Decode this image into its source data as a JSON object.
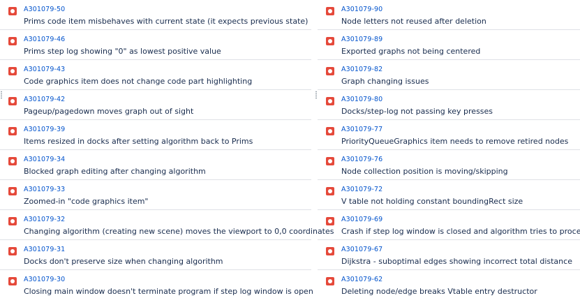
{
  "left_column": [
    {
      "key": "A301079-50",
      "summary": "Prims code item misbehaves with current state (it expects previous state)"
    },
    {
      "key": "A301079-46",
      "summary": "Prims step log showing \"0\" as lowest positive value"
    },
    {
      "key": "A301079-43",
      "summary": "Code graphics item does not change code part highlighting"
    },
    {
      "key": "A301079-42",
      "summary": "Pageup/pagedown moves graph out of sight"
    },
    {
      "key": "A301079-39",
      "summary": "Items resized in docks after setting algorithm back to Prims"
    },
    {
      "key": "A301079-34",
      "summary": "Blocked graph editing after changing algorithm"
    },
    {
      "key": "A301079-33",
      "summary": "Zoomed-in \"code graphics item\""
    },
    {
      "key": "A301079-32",
      "summary": "Changing algorithm (creating new scene) moves the viewport to 0,0 coordinates"
    },
    {
      "key": "A301079-31",
      "summary": "Docks don't preserve size when changing algorithm"
    },
    {
      "key": "A301079-30",
      "summary": "Closing main window doesn't terminate program if step log window is open"
    }
  ],
  "right_column": [
    {
      "key": "A301079-90",
      "summary": "Node letters not reused after deletion"
    },
    {
      "key": "A301079-89",
      "summary": "Exported graphs not being centered"
    },
    {
      "key": "A301079-82",
      "summary": "Graph changing issues"
    },
    {
      "key": "A301079-80",
      "summary": "Docks/step-log not passing key presses"
    },
    {
      "key": "A301079-77",
      "summary": "PriorityQueueGraphics item needs to remove retired nodes"
    },
    {
      "key": "A301079-76",
      "summary": "Node collection position is moving/skipping"
    },
    {
      "key": "A301079-72",
      "summary": "V table not holding constant boundingRect size"
    },
    {
      "key": "A301079-69",
      "summary": "Crash if step log window is closed and algorithm tries to proceed"
    },
    {
      "key": "A301079-67",
      "summary": "Dijkstra - suboptimal edges showing incorrect total distance"
    },
    {
      "key": "A301079-62",
      "summary": "Deleting node/edge breaks Vtable entry destructor"
    }
  ],
  "icon": {
    "name": "bug-icon",
    "color": "#e5493a"
  }
}
